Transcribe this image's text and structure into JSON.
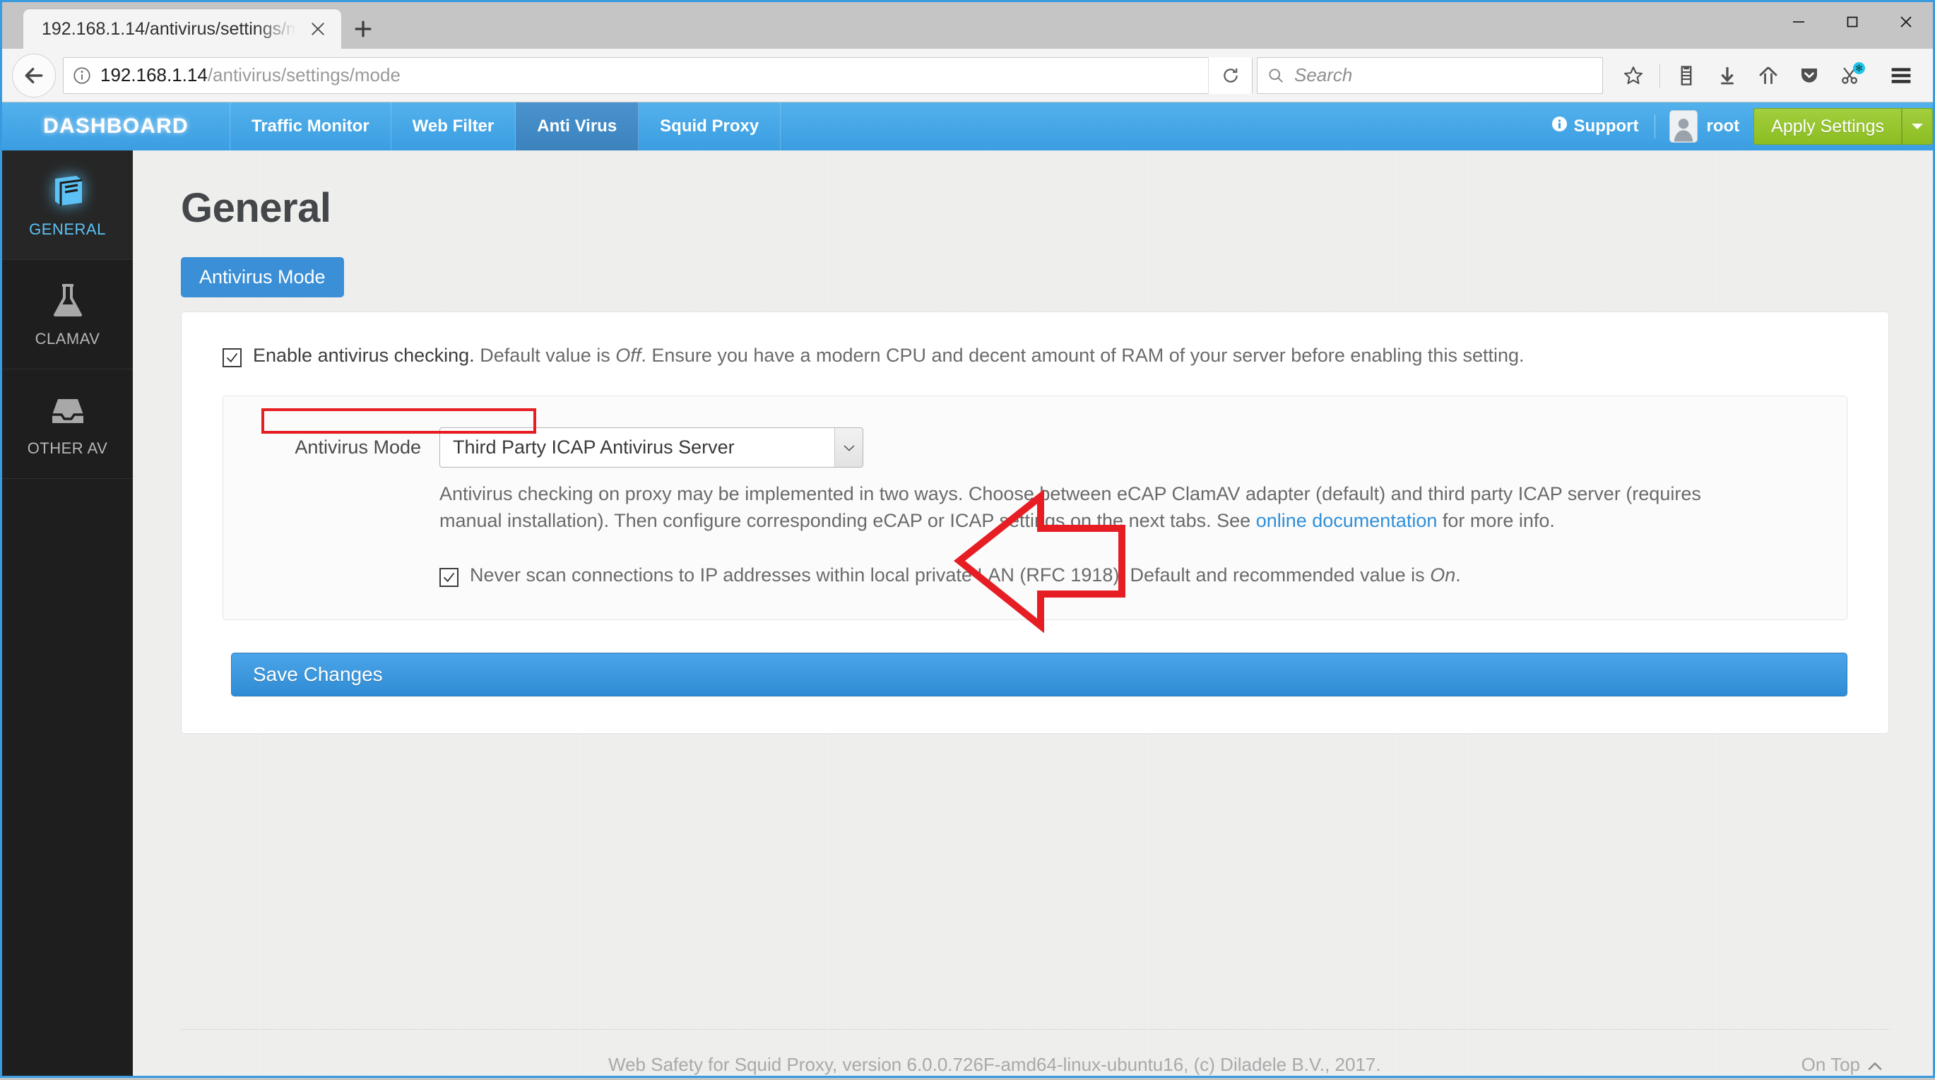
{
  "browser": {
    "tab_title": "192.168.1.14/antivirus/settings/m",
    "tab_close_icon": "close-icon",
    "new_tab_icon": "plus-icon",
    "window_minimize_icon": "minimize-icon",
    "window_maximize_icon": "maximize-icon",
    "window_close_icon": "close-icon",
    "back_icon": "back-arrow-icon",
    "site_info_icon": "info-circle-icon",
    "url_host": "192.168.1.14",
    "url_path": "/antivirus/settings/mode",
    "reload_icon": "reload-icon",
    "search_icon": "search-icon",
    "search_placeholder": "Search",
    "toolbar_icons": [
      "bookmark-star-icon",
      "library-icon",
      "downloads-icon",
      "home-icon",
      "pocket-icon",
      "screenshot-icon"
    ],
    "menu_icon": "hamburger-menu-icon"
  },
  "topnav": {
    "brand": "DASHBOARD",
    "items": [
      {
        "label": "Traffic Monitor",
        "active": false
      },
      {
        "label": "Web Filter",
        "active": false
      },
      {
        "label": "Anti Virus",
        "active": true
      },
      {
        "label": "Squid Proxy",
        "active": false
      }
    ],
    "support_label": "Support",
    "support_icon": "info-circle-icon",
    "user_name": "root",
    "avatar_icon": "user-avatar-icon",
    "apply_label": "Apply Settings",
    "apply_caret_icon": "caret-down-icon",
    "accent_blue": "#3b9ee2",
    "apply_green": "#8cbd22"
  },
  "sidebar": {
    "items": [
      {
        "label": "GENERAL",
        "icon": "book-icon",
        "active": true
      },
      {
        "label": "CLAMAV",
        "icon": "flask-icon",
        "active": false
      },
      {
        "label": "OTHER AV",
        "icon": "inbox-tray-icon",
        "active": false
      }
    ],
    "active_color": "#5cc2f5"
  },
  "main": {
    "page_title": "General",
    "tab_pill": "Antivirus Mode",
    "enable_checkbox": {
      "checked": true,
      "label": "Enable antivirus checking.",
      "description_before": " Default value is ",
      "description_em": "Off",
      "description_after": ". Ensure you have a modern CPU and decent amount of RAM of your server before enabling this setting.",
      "highlight_color": "#e71d24"
    },
    "mode_field": {
      "label": "Antivirus Mode",
      "selected_value": "Third Party ICAP Antivirus Server",
      "caret_icon": "chevron-down-icon"
    },
    "mode_help": {
      "part1": "Antivirus checking on proxy may be implemented in two ways. Choose between eCAP ClamAV adapter (default) and third party ICAP server (requires manual installation). Then configure corresponding eCAP or ICAP settings on the next tabs. See ",
      "link": "online documentation",
      "part2": " for more info."
    },
    "lan_checkbox": {
      "checked": true,
      "text_before": "Never scan connections to IP addresses within local private LAN (RFC 1918). Default and recommended value is ",
      "text_em": "On",
      "text_after": "."
    },
    "save_label": "Save Changes"
  },
  "footer": {
    "text": "Web Safety for Squid Proxy, version 6.0.0.726F-amd64-linux-ubuntu16, (c) Diladele B.V., 2017.",
    "ontop_label": "On Top",
    "ontop_icon": "chevron-up-icon"
  },
  "annotations": {
    "arrow_icon": "left-pointing-callout-arrow",
    "arrow_color": "#e71d24"
  }
}
